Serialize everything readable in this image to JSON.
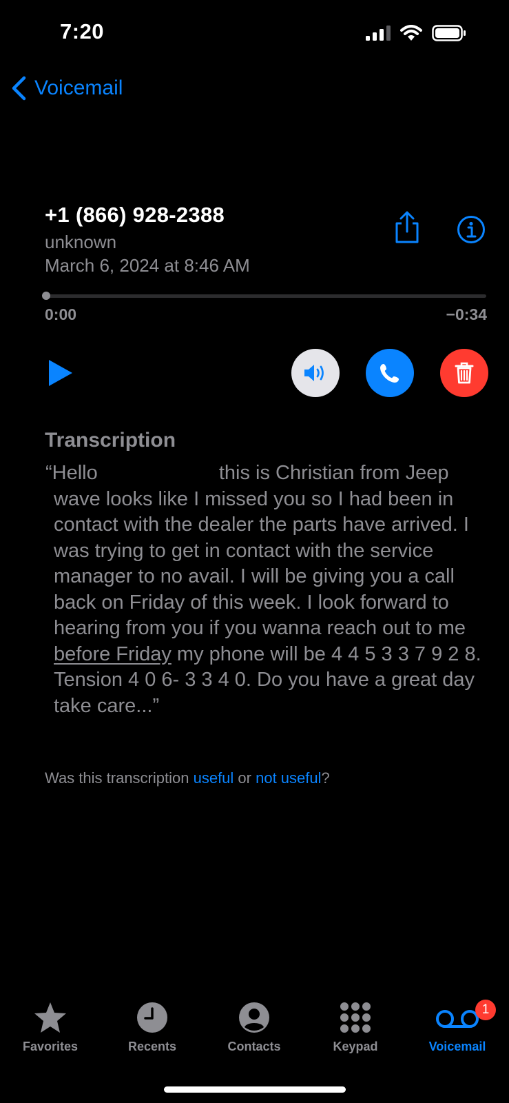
{
  "status_bar": {
    "time": "7:20"
  },
  "nav": {
    "back_label": "Voicemail"
  },
  "voicemail": {
    "phone_number": "+1 (866) 928-2388",
    "label": "unknown",
    "date": "March 6, 2024 at 8:46 AM",
    "elapsed": "0:00",
    "remaining": "−0:34",
    "progress": 0
  },
  "transcription": {
    "heading": "Transcription",
    "text_part1": "“Hello",
    "text_part2": "this is Christian from Jeep wave looks like I missed you so I had been in contact with the dealer the parts have arrived. I was trying to get in contact with the service manager to no avail. I will be giving you a call back on Friday of this week. I look forward to hearing from you if you wanna reach out to me ",
    "text_link": "before Friday",
    "text_part3": " my phone will be 4 4 5 3 3 7 9 2 8. Tension 4 0 6- 3 3 4 0. Do you have a great day take care...”",
    "feedback_prefix": "Was this transcription ",
    "feedback_useful": "useful",
    "feedback_or": " or ",
    "feedback_not_useful": "not useful",
    "feedback_suffix": "?"
  },
  "tab_bar": {
    "tabs": [
      {
        "label": "Favorites",
        "icon": "star-icon"
      },
      {
        "label": "Recents",
        "icon": "clock-icon"
      },
      {
        "label": "Contacts",
        "icon": "person-circle-icon"
      },
      {
        "label": "Keypad",
        "icon": "keypad-icon"
      },
      {
        "label": "Voicemail",
        "icon": "voicemail-icon"
      }
    ],
    "voicemail_badge": "1"
  },
  "colors": {
    "accent": "#0a84ff",
    "destructive": "#ff3b30",
    "secondary_text": "#8e8e93",
    "background": "#000000"
  }
}
